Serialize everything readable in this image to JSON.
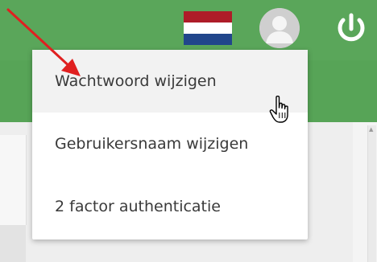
{
  "topbar": {
    "background_color": "#5aa65a",
    "flag_icon": "netherlands-flag-icon",
    "flag_colors": [
      "#ae1c28",
      "#ffffff",
      "#21468b"
    ],
    "avatar_icon": "user-avatar-icon",
    "power_icon": "power-icon"
  },
  "dropdown": {
    "items": [
      {
        "label": "Wachtwoord wijzigen",
        "hovered": true
      },
      {
        "label": "Gebruikersnaam wijzigen",
        "hovered": false
      },
      {
        "label": "2 factor authenticatie",
        "hovered": false
      }
    ]
  },
  "annotation": {
    "arrow_icon": "red-arrow-icon",
    "arrow_color": "#e02020",
    "cursor_icon": "hand-pointer-icon"
  }
}
